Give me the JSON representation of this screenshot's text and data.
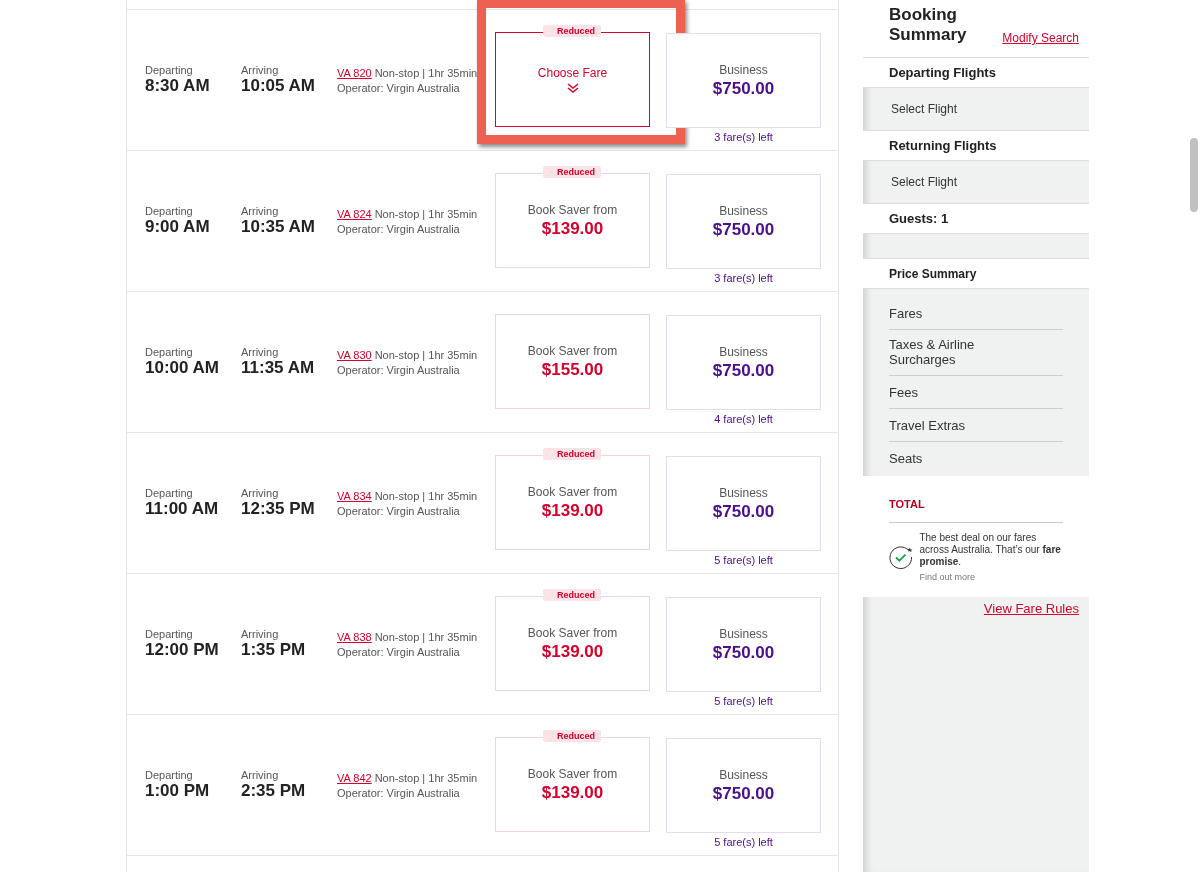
{
  "flights": [
    {
      "departing_label": "Departing",
      "departing_time": "8:30 AM",
      "arriving_label": "Arriving",
      "arriving_time": "10:05 AM",
      "flight_number": "VA 820",
      "details": "Non-stop | 1hr 35min",
      "operator": "Operator: Virgin Australia",
      "saver": {
        "kind": "choose",
        "badge": "Reduced",
        "label": "Choose Fare",
        "highlighted": true
      },
      "business": {
        "label": "Business",
        "price": "$750.00"
      },
      "fares_left": "3 fare(s) left"
    },
    {
      "departing_label": "Departing",
      "departing_time": "9:00 AM",
      "arriving_label": "Arriving",
      "arriving_time": "10:35 AM",
      "flight_number": "VA 824",
      "details": "Non-stop | 1hr 35min",
      "operator": "Operator: Virgin Australia",
      "saver": {
        "kind": "saver",
        "badge": "Reduced",
        "label": "Book Saver from",
        "price": "$139.00",
        "highlighted": false
      },
      "business": {
        "label": "Business",
        "price": "$750.00"
      },
      "fares_left": "3 fare(s) left"
    },
    {
      "departing_label": "Departing",
      "departing_time": "10:00 AM",
      "arriving_label": "Arriving",
      "arriving_time": "11:35 AM",
      "flight_number": "VA 830",
      "details": "Non-stop | 1hr 35min",
      "operator": "Operator: Virgin Australia",
      "saver": {
        "kind": "saver",
        "label": "Book Saver from",
        "price": "$155.00",
        "highlighted": false
      },
      "business": {
        "label": "Business",
        "price": "$750.00"
      },
      "fares_left": "4 fare(s) left"
    },
    {
      "departing_label": "Departing",
      "departing_time": "11:00 AM",
      "arriving_label": "Arriving",
      "arriving_time": "12:35 PM",
      "flight_number": "VA 834",
      "details": "Non-stop | 1hr 35min",
      "operator": "Operator: Virgin Australia",
      "saver": {
        "kind": "saver",
        "badge": "Reduced",
        "label": "Book Saver from",
        "price": "$139.00",
        "highlighted": false
      },
      "business": {
        "label": "Business",
        "price": "$750.00"
      },
      "fares_left": "5 fare(s) left"
    },
    {
      "departing_label": "Departing",
      "departing_time": "12:00 PM",
      "arriving_label": "Arriving",
      "arriving_time": "1:35 PM",
      "flight_number": "VA 838",
      "details": "Non-stop | 1hr 35min",
      "operator": "Operator: Virgin Australia",
      "saver": {
        "kind": "saver",
        "badge": "Reduced",
        "label": "Book Saver from",
        "price": "$139.00",
        "highlighted": false
      },
      "business": {
        "label": "Business",
        "price": "$750.00"
      },
      "fares_left": "5 fare(s) left"
    },
    {
      "departing_label": "Departing",
      "departing_time": "1:00 PM",
      "arriving_label": "Arriving",
      "arriving_time": "2:35 PM",
      "flight_number": "VA 842",
      "details": "Non-stop | 1hr 35min",
      "operator": "Operator: Virgin Australia",
      "saver": {
        "kind": "saver",
        "badge": "Reduced",
        "label": "Book Saver from",
        "price": "$139.00",
        "highlighted": false
      },
      "business": {
        "label": "Business",
        "price": "$750.00"
      },
      "fares_left": "5 fare(s) left"
    }
  ],
  "summary": {
    "title": "Booking Summary",
    "modify_link": "Modify Search",
    "sections": [
      {
        "heading": "Departing Flights",
        "value": "Select Flight"
      },
      {
        "heading": "Returning Flights",
        "value": "Select Flight"
      }
    ],
    "guests": "Guests: 1",
    "price_heading": "Price Summary",
    "price_items": [
      "Fares",
      "Taxes & Airline Surcharges",
      "Fees",
      "Travel Extras",
      "Seats"
    ],
    "total_label": "TOTAL",
    "promise_text": "The best deal on our fares across Australia. That’s our **fare promise**.",
    "promise_link": "Find out more",
    "fare_rules_link": "View Fare Rules"
  }
}
